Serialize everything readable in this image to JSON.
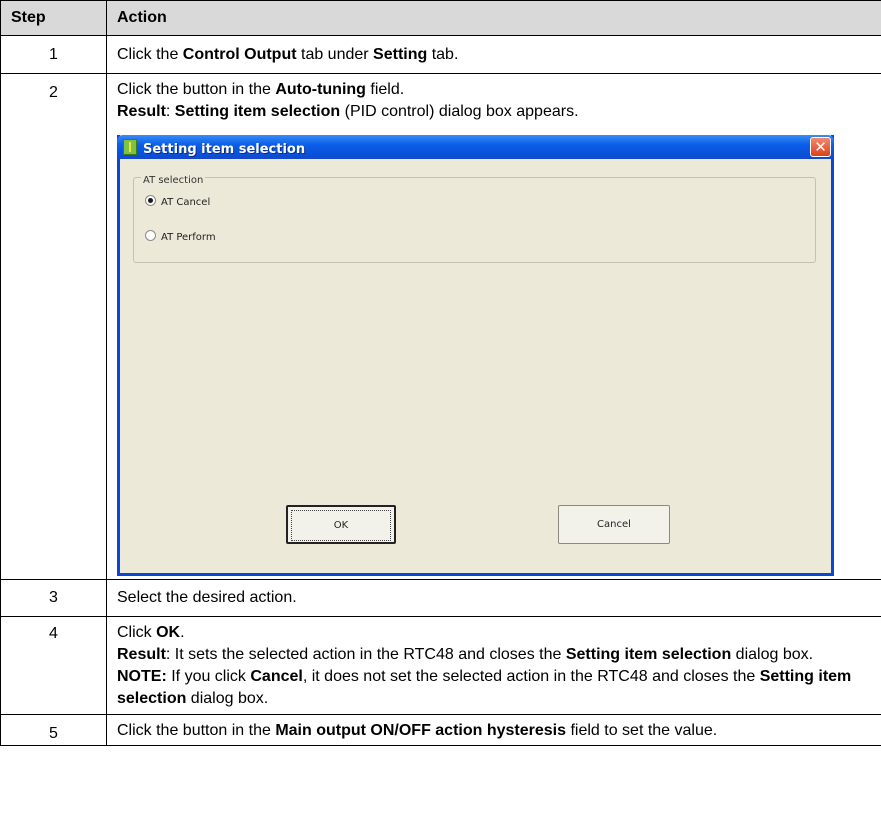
{
  "headers": {
    "step": "Step",
    "action": "Action"
  },
  "rows": [
    {
      "step": "1",
      "a": "Click the ",
      "b": "Control Output",
      "c": " tab under ",
      "d": "Setting",
      "e": " tab."
    },
    {
      "step": "2",
      "l1a": "Click the button in the ",
      "l1b": "Auto-tuning",
      "l1c": " field.",
      "l2a": "Result",
      "l2b": ": ",
      "l2c": "Setting item selection",
      "l2d": " (PID control) dialog box appears."
    },
    {
      "step": "3",
      "text": "Select the desired action."
    },
    {
      "step": "4",
      "l1a": "Click ",
      "l1b": "OK",
      "l1c": ".",
      "l2a": "Result",
      "l2b": ": It sets the selected action in the RTC48 and closes the ",
      "l2c": "Setting item selection",
      "l2d": " dialog box.",
      "l3a": "NOTE:",
      "l3b": " If you click ",
      "l3c": "Cancel",
      "l3d": ", it does not set the selected action in the RTC48 and closes the ",
      "l3e": "Setting item selection",
      "l3f": " dialog box."
    },
    {
      "step": "5",
      "a": "Click the button in the ",
      "b": "Main output ON/OFF action hysteresis",
      "c": " field to set the value."
    }
  ],
  "dialog": {
    "title": "Setting item selection",
    "close_glyph": "✕",
    "icon": "app-icon",
    "group_label": "AT selection",
    "options": [
      {
        "label": "AT Cancel",
        "selected": true
      },
      {
        "label": "AT Perform",
        "selected": false
      }
    ],
    "ok_label": "OK",
    "cancel_label": "Cancel"
  }
}
